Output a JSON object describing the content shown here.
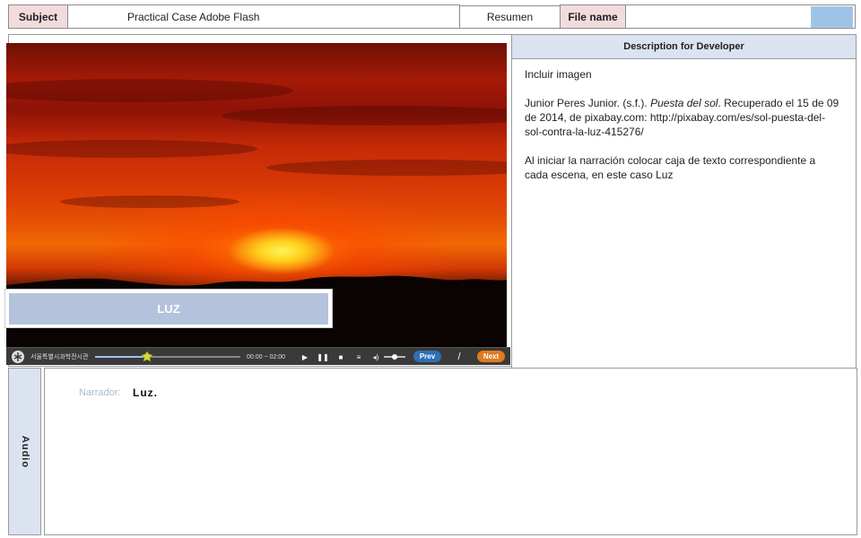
{
  "header": {
    "subject_label": "Subject",
    "subject_value": "Practical Case Adobe Flash",
    "resumen_tab": "Resumen",
    "file_name_label": "File name",
    "file_name_value": ""
  },
  "description": {
    "title": "Description for Developer",
    "line1": "Incluir imagen",
    "ref_author": "Junior Peres Junior. (s.f.). ",
    "ref_title": "Puesta del sol",
    "ref_rest": ". Recuperado el 15 de 09 de 2014, de pixabay.com: http://pixabay.com/es/sol-puesta-del-sol-contra-la-luz-415276/",
    "instruction": "Al iniciar la narración colocar caja de texto correspondiente a cada escena, en este caso Luz"
  },
  "scene": {
    "caption": "LUZ"
  },
  "player": {
    "logo_text": "서울특별시과학전시관",
    "time": "00:00 ~ 02:00",
    "progress": 0.36,
    "volume": 0.5,
    "prev_label": "Prev",
    "separator": "/",
    "next_label": "Next",
    "colors": {
      "prev": "#2f6fb5",
      "next": "#e07b1f",
      "progress": "#9fc3e8"
    }
  },
  "audio": {
    "label": "Audio",
    "narrator_label": "Narrador:",
    "narrator_text": "Luz."
  }
}
